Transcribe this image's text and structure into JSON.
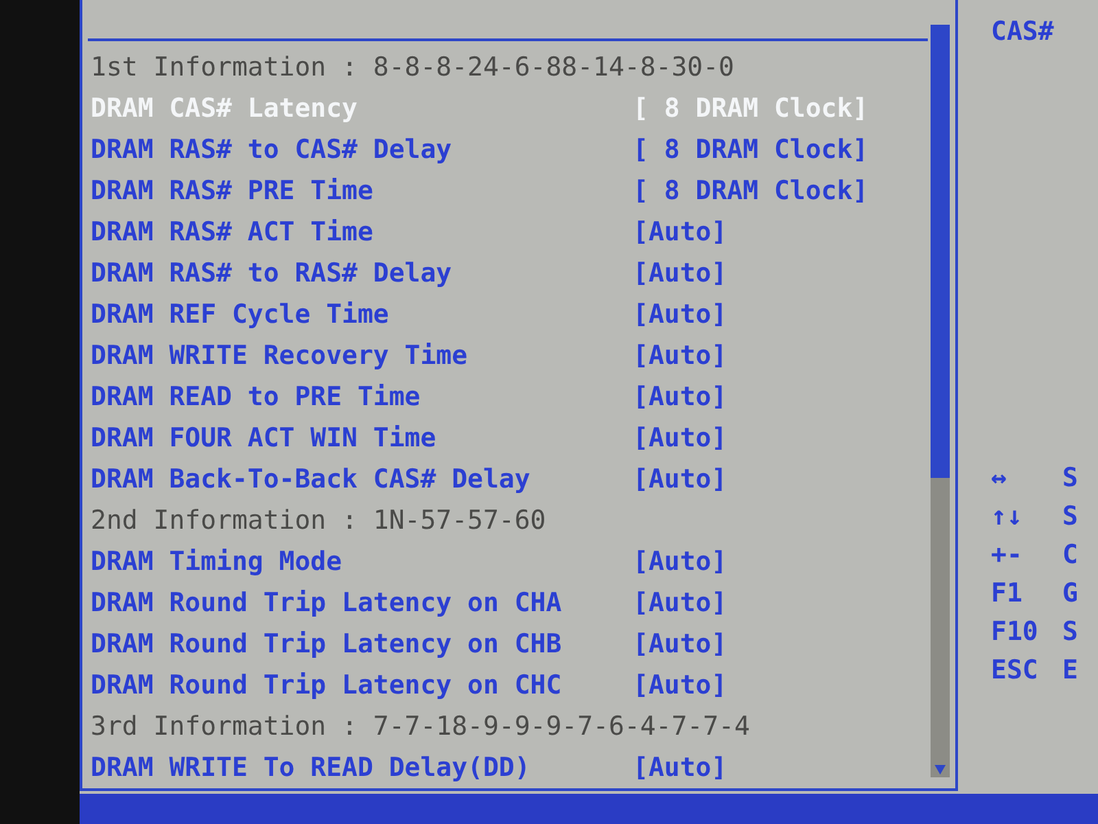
{
  "top_hint": "CAS#",
  "rows": [
    {
      "kind": "info",
      "label": "1st Information : 8-8-8-24-6-88-14-8-30-0"
    },
    {
      "kind": "setting",
      "label": "DRAM CAS# Latency",
      "value": "[ 8 DRAM Clock]",
      "selected": true
    },
    {
      "kind": "setting",
      "label": "DRAM RAS# to CAS# Delay",
      "value": "[ 8 DRAM Clock]",
      "selected": false
    },
    {
      "kind": "setting",
      "label": "DRAM RAS# PRE Time",
      "value": "[ 8 DRAM Clock]",
      "selected": false
    },
    {
      "kind": "setting",
      "label": "DRAM RAS# ACT Time",
      "value": "[Auto]",
      "selected": false
    },
    {
      "kind": "setting",
      "label": "DRAM RAS# to RAS# Delay",
      "value": "[Auto]",
      "selected": false
    },
    {
      "kind": "setting",
      "label": "DRAM REF Cycle Time",
      "value": "[Auto]",
      "selected": false
    },
    {
      "kind": "setting",
      "label": "DRAM WRITE Recovery Time",
      "value": "[Auto]",
      "selected": false
    },
    {
      "kind": "setting",
      "label": "DRAM READ to PRE Time",
      "value": "[Auto]",
      "selected": false
    },
    {
      "kind": "setting",
      "label": "DRAM FOUR ACT WIN Time",
      "value": "[Auto]",
      "selected": false
    },
    {
      "kind": "setting",
      "label": "DRAM Back-To-Back CAS# Delay",
      "value": "[Auto]",
      "selected": false
    },
    {
      "kind": "info",
      "label": "2nd Information : 1N-57-57-60"
    },
    {
      "kind": "setting",
      "label": "DRAM Timing Mode",
      "value": "[Auto]",
      "selected": false
    },
    {
      "kind": "setting",
      "label": "DRAM Round Trip Latency on CHA",
      "value": "[Auto]",
      "selected": false
    },
    {
      "kind": "setting",
      "label": "DRAM Round Trip Latency on CHB",
      "value": "[Auto]",
      "selected": false
    },
    {
      "kind": "setting",
      "label": "DRAM Round Trip Latency on CHC",
      "value": "[Auto]",
      "selected": false
    },
    {
      "kind": "info",
      "label": "3rd Information : 7-7-18-9-9-9-7-6-4-7-7-4"
    },
    {
      "kind": "setting",
      "label": "DRAM WRITE To READ Delay(DD)",
      "value": "[Auto]",
      "selected": false
    }
  ],
  "help_keys": [
    {
      "key": "↔",
      "desc": "S"
    },
    {
      "key": "↑↓",
      "desc": "S"
    },
    {
      "key": "+-",
      "desc": "C"
    },
    {
      "key": "F1",
      "desc": "G"
    },
    {
      "key": "F10",
      "desc": "S"
    },
    {
      "key": "ESC",
      "desc": "E"
    }
  ]
}
